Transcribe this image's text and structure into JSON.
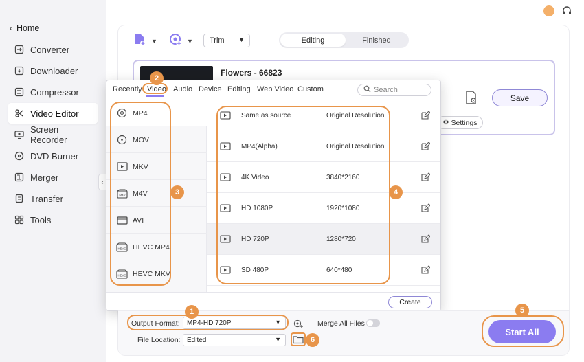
{
  "sidebar": {
    "home_label": "Home",
    "items": [
      {
        "label": "Converter",
        "icon": "converter-icon"
      },
      {
        "label": "Downloader",
        "icon": "downloader-icon"
      },
      {
        "label": "Compressor",
        "icon": "compressor-icon"
      },
      {
        "label": "Video Editor",
        "icon": "scissors-icon",
        "active": true
      },
      {
        "label": "Screen Recorder",
        "icon": "screen-recorder-icon"
      },
      {
        "label": "DVD Burner",
        "icon": "disc-icon"
      },
      {
        "label": "Merger",
        "icon": "merger-icon"
      },
      {
        "label": "Transfer",
        "icon": "transfer-icon"
      },
      {
        "label": "Tools",
        "icon": "tools-icon"
      }
    ]
  },
  "toolbar": {
    "trim_label": "Trim",
    "tabs": [
      "Editing",
      "Finished"
    ],
    "active_tab": "Editing"
  },
  "file": {
    "name": "Flowers - 66823",
    "save_label": "Save",
    "settings_label": "Settings"
  },
  "format_popup": {
    "tabs": [
      "Recently",
      "Video",
      "Audio",
      "Device",
      "Editing",
      "Web Video",
      "Custom"
    ],
    "active_tab": "Video",
    "search_placeholder": "Search",
    "formats": [
      "MP4",
      "MOV",
      "MKV",
      "M4V",
      "AVI",
      "HEVC MP4",
      "HEVC MKV"
    ],
    "selected_format": "MP4",
    "resolutions": [
      {
        "name": "Same as source",
        "value": "Original Resolution"
      },
      {
        "name": "MP4(Alpha)",
        "value": "Original Resolution"
      },
      {
        "name": "4K Video",
        "value": "3840*2160"
      },
      {
        "name": "HD 1080P",
        "value": "1920*1080"
      },
      {
        "name": "HD 720P",
        "value": "1280*720"
      },
      {
        "name": "SD 480P",
        "value": "640*480"
      }
    ],
    "selected_resolution": "HD 720P",
    "create_label": "Create"
  },
  "bottom": {
    "output_format_label": "Output Format:",
    "output_format_value": "MP4-HD 720P",
    "merge_label": "Merge All Files",
    "file_location_label": "File Location:",
    "file_location_value": "Edited",
    "start_all_label": "Start All"
  },
  "annotations": [
    "1",
    "2",
    "3",
    "4",
    "5",
    "6"
  ],
  "colors": {
    "accent": "#8b7cf0",
    "annotation": "#e8954a",
    "sidebar_bg": "#f3f3f6"
  }
}
